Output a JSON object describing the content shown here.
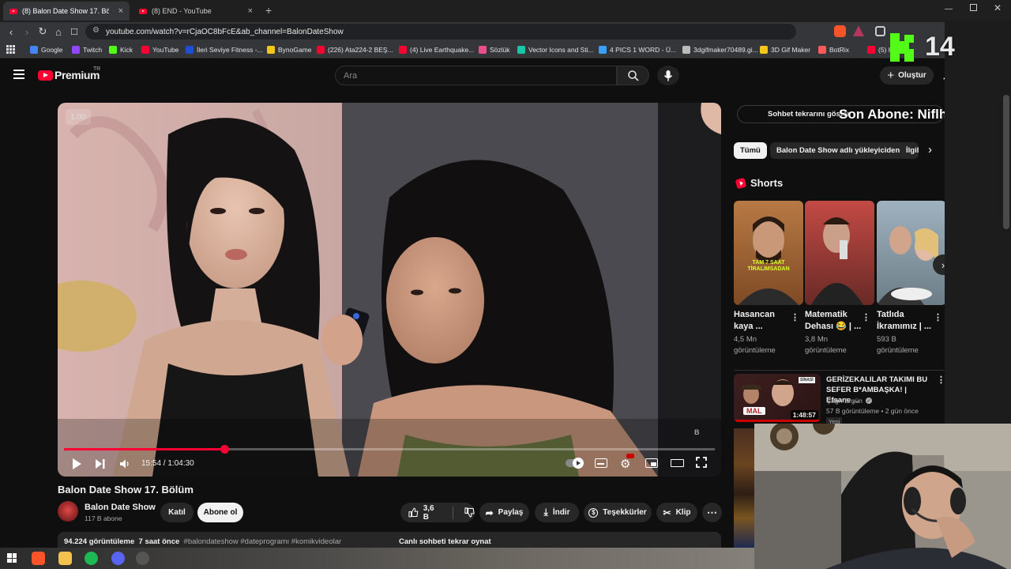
{
  "browser": {
    "tabs": [
      {
        "label": "(8) Balon Date Show 17. Bölüm",
        "close": "×"
      },
      {
        "label": "(8) END - YouTube",
        "close": "×"
      }
    ],
    "new_tab": "+",
    "url": "youtube.com/watch?v=rCjaOC8bFcE&ab_channel=BalonDateShow",
    "bookmarks": [
      {
        "label": "Google",
        "color": "#4285f4"
      },
      {
        "label": "Twitch",
        "color": "#9146ff"
      },
      {
        "label": "Kick",
        "color": "#53fc18"
      },
      {
        "label": "YouTube",
        "color": "#ff0033"
      },
      {
        "label": "İleri Seviye Fitness -...",
        "color": "#1d4ed8"
      },
      {
        "label": "BynoGame",
        "color": "#f5c518"
      },
      {
        "label": "(226) Ata224-2 BEŞ...",
        "color": "#ff0033"
      },
      {
        "label": "(4) Live Earthquake...",
        "color": "#ff0033"
      },
      {
        "label": "Sözlük",
        "color": "#e94d8a"
      },
      {
        "label": "Vector Icons and Sti...",
        "color": "#18c6a5"
      },
      {
        "label": "4 PICS 1 WORD - Ü...",
        "color": "#3aa0ff"
      },
      {
        "label": "3dgifmaker70489.gi...",
        "color": "#bbbbbb"
      },
      {
        "label": "3D Gif Maker",
        "color": "#f5c518"
      },
      {
        "label": "BotRix",
        "color": "#ff5a5a"
      },
      {
        "label": "(5) Hype y...",
        "color": "#ff0033"
      }
    ]
  },
  "masthead": {
    "logo": "Premium",
    "region": "TR",
    "search_placeholder": "Ara",
    "create_label": "Oluştur",
    "notif_count": "8"
  },
  "player": {
    "speed_badge": "1.00",
    "time": "15:54 / 1:04:30",
    "progress": 0.2465,
    "watermark": "B"
  },
  "video": {
    "title": "Balon Date Show 17. Bölüm",
    "channel": "Balon Date Show",
    "subs": "117 B abone",
    "join_label": "Katıl",
    "subscribe_label": "Abone ol",
    "likes": "3,6 B",
    "share_label": "Paylaş",
    "download_label": "İndir",
    "thanks_label": "Teşekkürler",
    "clip_label": "Klip",
    "more": "⋯",
    "views": "94.224 görüntüleme",
    "age": "7 saat önce",
    "hashtags": "#balondateshow #dateprogramı #komikvideolar",
    "chat_replay": "Canlı sohbeti tekrar oynat"
  },
  "sidebar": {
    "chat_replay_button": "Sohbet tekrarını göster",
    "chips": [
      "Tümü",
      "Balon Date Show adlı yükleyiciden",
      "İlgili"
    ],
    "shorts_heading": "Shorts",
    "shorts": [
      {
        "title": "Hasancan kaya ...",
        "meta": "4,5 Mn görüntüleme",
        "caption": "TAM 7 SAAT TİRALIMSADAN"
      },
      {
        "title": "Matematik Dehası 😂 | ...",
        "meta": "3,8 Mn görüntüleme",
        "caption": ""
      },
      {
        "title": "Tatlıda İkramımız | ...",
        "meta": "593 B görüntüleme",
        "caption": ""
      }
    ],
    "rec": {
      "title": "GERİZEKALILAR TAKIMI BU SEFER B*AMBAŞKA! | Efsane ...",
      "channel": "Çağrı Ergün",
      "meta": "57 B görüntüleme • 2 gün önce",
      "badge": "Yeni",
      "duration": "1:48:57",
      "thumb_text": "MAL",
      "thumb_text2": "SİNASİ"
    }
  },
  "overlay": {
    "last_sub": "Son Abone: Niflheimgg",
    "kick_number": "14"
  }
}
